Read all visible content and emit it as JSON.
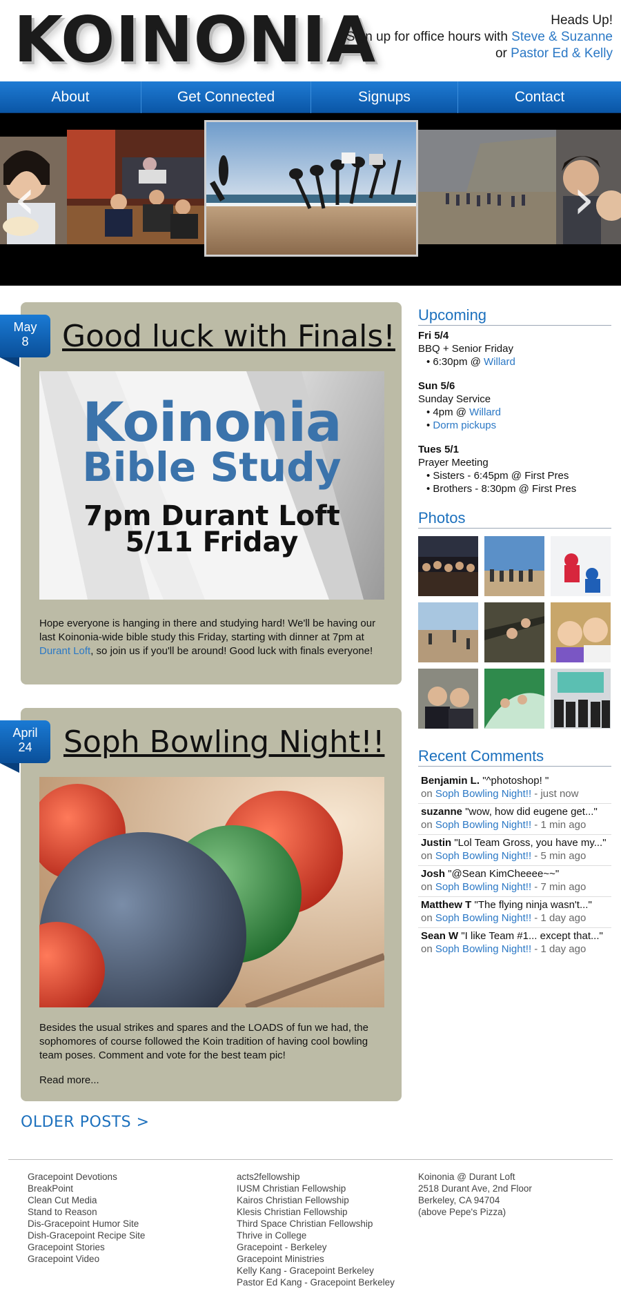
{
  "header": {
    "logo_text": "KOINONIA",
    "heads_up_title": "Heads Up!",
    "signup_text": "Sign up for office hours with ",
    "signup_link1": "Steve & Suzanne",
    "or_text": "or ",
    "signup_link2": "Pastor Ed & Kelly"
  },
  "nav": {
    "items": [
      {
        "label": "About"
      },
      {
        "label": "Get Connected"
      },
      {
        "label": "Signups"
      },
      {
        "label": "Contact"
      }
    ]
  },
  "carousel": {
    "prev_icon": "‹",
    "next_icon": "›"
  },
  "posts": [
    {
      "month": "May",
      "day": "8",
      "title": "Good luck with Finals!",
      "image": {
        "line1": "Koinonia",
        "line2": "Bible Study",
        "line3": "7pm Durant Loft",
        "line4": "5/11 Friday"
      },
      "body_part1": "Hope everyone is hanging in there and studying hard! We'll be having our last Koinonia-wide bible study this Friday, starting with dinner at 7pm at ",
      "body_link": "Durant Loft",
      "body_part2": ", so join us if you'll be around! Good luck with finals everyone!"
    },
    {
      "month": "April",
      "day": "24",
      "title": "Soph Bowling Night!!",
      "body": "Besides the usual strikes and spares and the LOADS of fun we had, the sophomores of course followed the Koin tradition of having cool bowl­ing team poses. Comment and vote for the best team pic!",
      "read_more": "Read more..."
    }
  ],
  "sidebar": {
    "upcoming_title": "Upcoming",
    "events": [
      {
        "date": "Fri 5/4",
        "name": "BBQ + Senior Friday",
        "items": [
          {
            "text": "6:30pm @ ",
            "link": "Willard"
          }
        ]
      },
      {
        "date": "Sun 5/6",
        "name": "Sunday Service",
        "items": [
          {
            "text": "4pm @ ",
            "link": "Willard"
          },
          {
            "text": "",
            "link": "Dorm pickups"
          }
        ]
      },
      {
        "date": "Tues 5/1",
        "name": "Prayer Meeting",
        "items": [
          {
            "text": "Sisters - 6:45pm @ First Pres",
            "link": ""
          },
          {
            "text": "Brothers - 8:30pm @ First Pres",
            "link": ""
          }
        ]
      }
    ],
    "photos_title": "Photos",
    "comments_title": "Recent Comments",
    "comments": [
      {
        "author": "Benjamin L.",
        "text": "\"^photoshop!  \"",
        "on": "on ",
        "post": "Soph Bowling Night!!",
        "time": " - just now"
      },
      {
        "author": "suzanne",
        "text": "\"wow, how did eugene get...\"",
        "on": "on ",
        "post": "Soph Bowling Night!!",
        "time": " - 1 min ago"
      },
      {
        "author": "Justin",
        "text": "\"Lol Team Gross, you have my...\"",
        "on": "on ",
        "post": "Soph Bowling Night!!",
        "time": " - 5 min ago"
      },
      {
        "author": "Josh",
        "text": "\"@Sean KimCheeee~~\"",
        "on": "on ",
        "post": "Soph Bowling Night!!",
        "time": " - 7 min ago"
      },
      {
        "author": "Matthew T",
        "text": "\"The flying ninja wasn't...\"",
        "on": "on ",
        "post": "Soph Bowling Night!!",
        "time": " - 1 day ago"
      },
      {
        "author": "Sean W",
        "text": "\"I like Team #1... except that...\"",
        "on": "on ",
        "post": "Soph Bowling Night!!",
        "time": " - 1 day ago"
      }
    ]
  },
  "older_posts": "OLDER POSTS  >",
  "footer": {
    "col1": [
      "Gracepoint Devotions",
      "BreakPoint",
      "Clean Cut Media",
      "Stand to Reason",
      "Dis-Gracepoint Humor Site",
      "Dish-Gracepoint Recipe Site",
      "Gracepoint Stories",
      "Gracepoint Video"
    ],
    "col2": [
      "acts2fellowship",
      "IUSM Christian Fellowship",
      "Kairos Christian Fellowship",
      "Klesis Christian Fellowship",
      "Third Space Christian Fellowship",
      "Thrive in College",
      "Gracepoint - Berkeley",
      "Gracepoint Ministries",
      "Kelly Kang - Gracepoint Berkeley",
      "Pastor Ed Kang - Gracepoint Berkeley"
    ],
    "address": [
      "Koinonia @ Durant Loft",
      "2518 Durant Ave, 2nd Floor",
      "Berkeley, CA 94704",
      "(above Pepe's Pizza)"
    ]
  }
}
